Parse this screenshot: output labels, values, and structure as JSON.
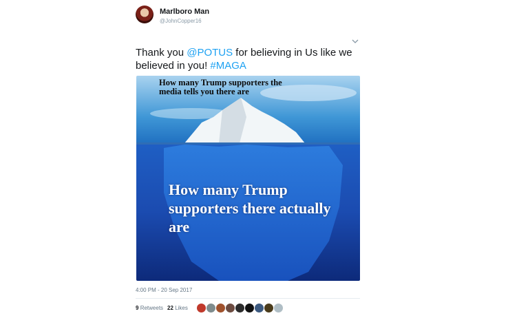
{
  "tweet": {
    "author_name": "Marlboro Man",
    "author_handle": "@JohnCopper16",
    "text_pre": "Thank you ",
    "mention": "@POTUS",
    "text_mid": " for believing in Us like we believed in you! ",
    "hashtag": "#MAGA",
    "timestamp": "4:00 PM - 20 Sep 2017"
  },
  "image": {
    "top_caption": "How many Trump supporters the media tells you there are",
    "bottom_caption": "How many Trump supporters there actually are"
  },
  "stats": {
    "retweets_count": "9",
    "retweets_label": "Retweets",
    "likes_count": "22",
    "likes_label": "Likes"
  },
  "liker_avatar_colors": [
    "#c0392b",
    "#7f8c8d",
    "#a0522d",
    "#6d4c41",
    "#2c2c2c",
    "#111111",
    "#3d5a80",
    "#4a3b1b",
    "#b0bec5"
  ],
  "colors": {
    "accent": "#1da1f2",
    "text": "#14171a",
    "muted": "#657786"
  }
}
